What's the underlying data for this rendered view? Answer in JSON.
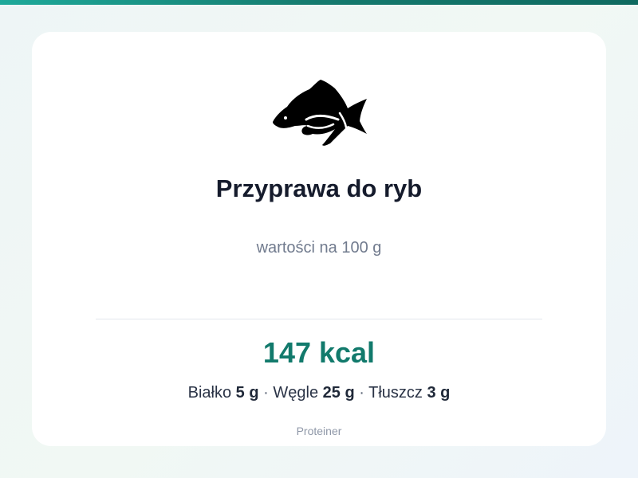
{
  "theme": {
    "accent": "#127a6c",
    "top_bar_gradient": [
      "#1ea99a",
      "#0f6a60"
    ],
    "card_background": "#ffffff"
  },
  "product": {
    "icon": "fish-icon",
    "name": "Przyprawa do ryb",
    "basis": "wartości na 100 g"
  },
  "nutrition": {
    "energy": "147 kcal",
    "macros": [
      {
        "label": "Białko",
        "value": "5 g"
      },
      {
        "label": "Węgle",
        "value": "25 g"
      },
      {
        "label": "Tłuszcz",
        "value": "3 g"
      }
    ],
    "separator": "·"
  },
  "footer": {
    "brand": "Proteiner"
  }
}
